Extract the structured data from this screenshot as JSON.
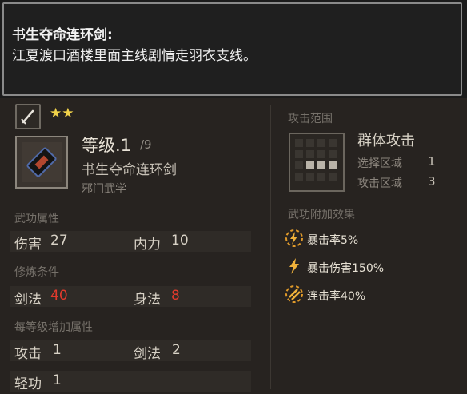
{
  "tooltip": {
    "title": "书生夺命连环剑:",
    "description": "江夏渡口酒楼里面主线剧情走羽衣支线。"
  },
  "item": {
    "stars": "★★",
    "level_text": "等级.1",
    "level_max": "/9",
    "name": "书生夺命连环剑",
    "type": "邪门武学"
  },
  "sections": {
    "attributes": "武功属性",
    "requirements": "修炼条件",
    "growth": "每等级增加属性"
  },
  "attributes": {
    "damage_label": "伤害",
    "damage_value": "27",
    "internal_label": "内力",
    "internal_value": "10"
  },
  "requirements": {
    "sword_label": "剑法",
    "sword_value": "40",
    "body_label": "身法",
    "body_value": "8"
  },
  "growth": {
    "attack_label": "攻击",
    "attack_value": "1",
    "sword_label": "剑法",
    "sword_value": "2",
    "qinggong_label": "轻功",
    "qinggong_value": "1"
  },
  "range": {
    "header": "攻击范围",
    "type": "群体攻击",
    "select_label": "选择区域",
    "select_value": "1",
    "attack_label": "攻击区域",
    "attack_value": "3"
  },
  "effects": {
    "header": "武功附加效果",
    "items": [
      {
        "icon": "crit-rate-icon",
        "text": "暴击率5%"
      },
      {
        "icon": "crit-damage-icon",
        "text": "暴击伤害150%"
      },
      {
        "icon": "combo-rate-icon",
        "text": "连击率40%"
      }
    ]
  },
  "colors": {
    "star": "#f1d24a",
    "requirement_unmet": "#e23a2c",
    "effect_icon": "#e09a2a"
  }
}
